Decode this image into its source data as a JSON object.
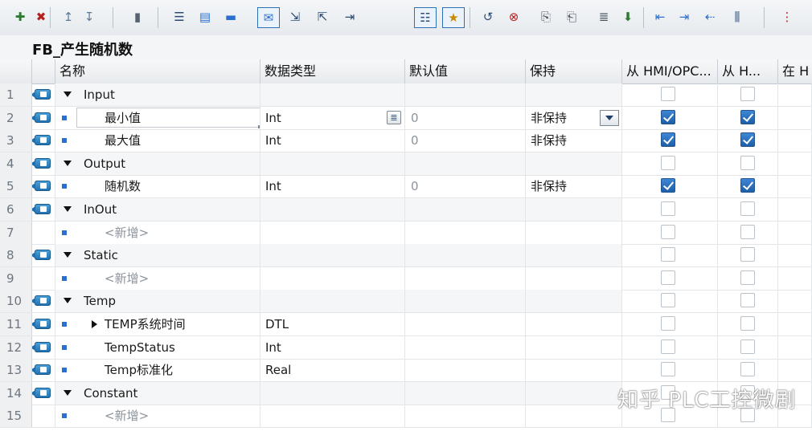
{
  "block": {
    "title": "FB_产生随机数"
  },
  "toolbar": {
    "icons": [
      "insert-row-icon",
      "delete-row-icon",
      "insert-above-icon",
      "insert-below-icon",
      "shift-icon",
      "outline-icon",
      "monitor-icon",
      "display-icon",
      "comment-icon",
      "expand-icon",
      "collapse-icon",
      "jump-icon",
      "list-icon",
      "favorites-icon",
      "reset-icon",
      "delete-segment-icon",
      "copy-icon",
      "paste-icon",
      "align-icon",
      "download-icon",
      "indent-left-icon",
      "indent-right-icon",
      "outdent-icon",
      "properties-icon",
      "more-icon"
    ]
  },
  "columns": {
    "name": "名称",
    "data_type": "数据类型",
    "default": "默认值",
    "retain": "保持",
    "hmi_access": "从 HMI/OPC...",
    "hmi_write": "从 H...",
    "hmi_visible": "在 H"
  },
  "rows": [
    {
      "num": "1",
      "kind": "section",
      "label": "Input",
      "io": true
    },
    {
      "num": "2",
      "kind": "member",
      "label": "最小值",
      "io": true,
      "type": "Int",
      "default": "0",
      "retain": "非保持",
      "hmi": true,
      "hmi2": true,
      "editing": true
    },
    {
      "num": "3",
      "kind": "member",
      "label": "最大值",
      "io": true,
      "type": "Int",
      "default": "0",
      "retain": "非保持",
      "hmi": true,
      "hmi2": true
    },
    {
      "num": "4",
      "kind": "section",
      "label": "Output",
      "io": true
    },
    {
      "num": "5",
      "kind": "member",
      "label": "随机数",
      "io": true,
      "type": "Int",
      "default": "0",
      "retain": "非保持",
      "hmi": true,
      "hmi2": true
    },
    {
      "num": "6",
      "kind": "section",
      "label": "InOut",
      "io": true
    },
    {
      "num": "7",
      "kind": "placeholder",
      "label": "<新增>",
      "io": false
    },
    {
      "num": "8",
      "kind": "section",
      "label": "Static",
      "io": true
    },
    {
      "num": "9",
      "kind": "placeholder",
      "label": "<新增>",
      "io": false
    },
    {
      "num": "10",
      "kind": "section",
      "label": "Temp",
      "io": true
    },
    {
      "num": "11",
      "kind": "member",
      "label": "TEMP系统时间",
      "io": true,
      "type": "DTL",
      "expandable": true
    },
    {
      "num": "12",
      "kind": "member",
      "label": "TempStatus",
      "io": true,
      "type": "Int"
    },
    {
      "num": "13",
      "kind": "member",
      "label": "Temp标准化",
      "io": true,
      "type": "Real"
    },
    {
      "num": "14",
      "kind": "section",
      "label": "Constant",
      "io": true
    },
    {
      "num": "15",
      "kind": "placeholder",
      "label": "<新增>",
      "io": false
    }
  ],
  "watermark": "知乎 PLC工控微剧"
}
